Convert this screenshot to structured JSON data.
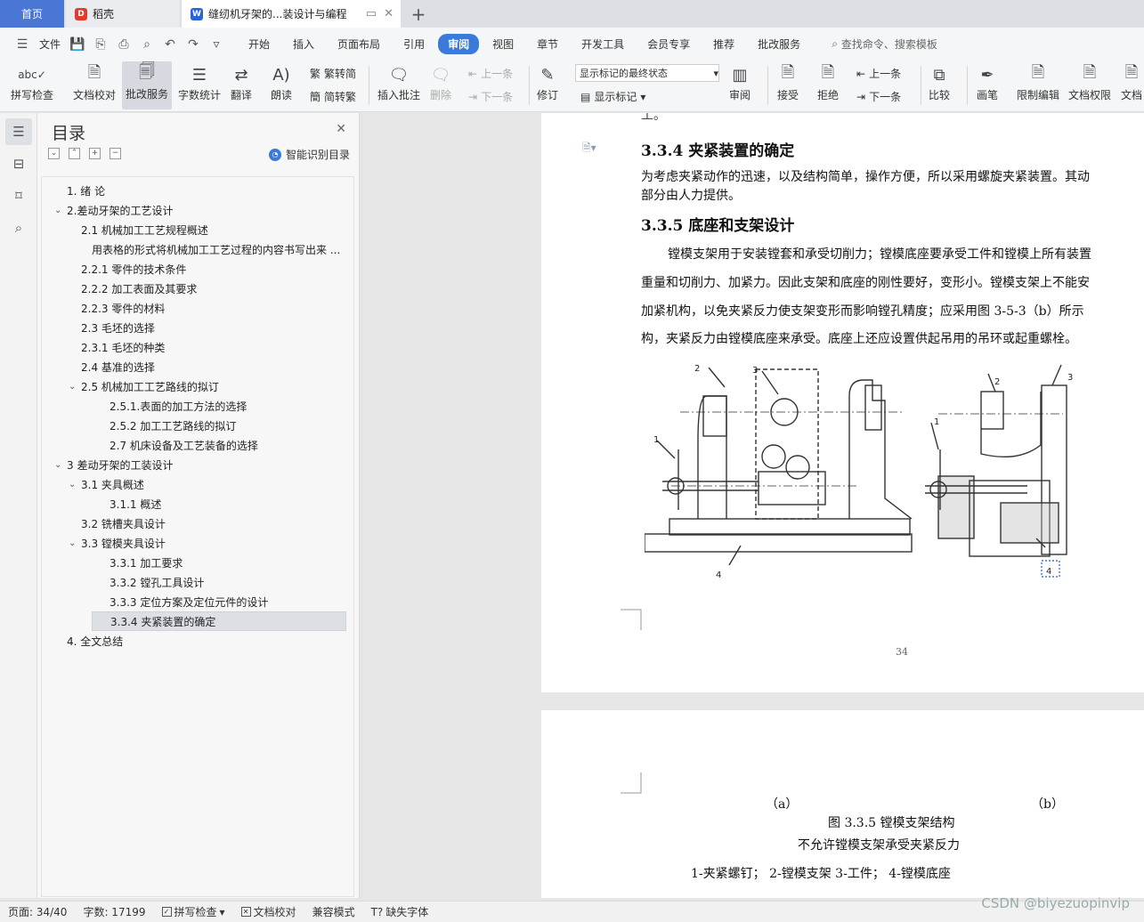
{
  "tabs": {
    "home": "首页",
    "daoke": "稻壳",
    "doc": "缝纫机牙架的...装设计与编程"
  },
  "menu": {
    "file": "文件",
    "tabs": [
      "开始",
      "插入",
      "页面布局",
      "引用",
      "审阅",
      "视图",
      "章节",
      "开发工具",
      "会员专享",
      "推荐",
      "批改服务"
    ],
    "active_tab": "审阅",
    "search": "查找命令、搜索模板"
  },
  "ribbon": {
    "spell": "拼写检查",
    "proofread": "文档校对",
    "correction": "批改服务",
    "wordcount": "字数统计",
    "translate": "翻译",
    "read": "朗读",
    "trad_simp": "繁转简",
    "simp_trad": "简转繁",
    "insert_comment": "插入批注",
    "delete": "删除",
    "prev_comment": "上一条",
    "next_comment": "下一条",
    "revise": "修订",
    "markup_state": "显示标记的最终状态",
    "show_markup": "显示标记",
    "review": "审阅",
    "accept": "接受",
    "reject": "拒绝",
    "prev": "上一条",
    "next": "下一条",
    "compare": "比较",
    "pen": "画笔",
    "restrict": "限制编辑",
    "permission": "文档权限",
    "more": "文档"
  },
  "toc": {
    "title": "目录",
    "smart": "智能识别目录",
    "items": [
      {
        "text": "1. 绪  论"
      },
      {
        "text": "2.差动牙架的工艺设计"
      },
      {
        "text": "2.1    机械加工工艺规程概述"
      },
      {
        "text": "用表格的形式将机械加工工艺过程的内容书写出来 ..."
      },
      {
        "text": "2.2.1  零件的技术条件"
      },
      {
        "text": "2.2.2  加工表面及其要求"
      },
      {
        "text": "2.2.3 零件的材料"
      },
      {
        "text": "2.3 毛坯的选择"
      },
      {
        "text": "2.3.1 毛坯的种类"
      },
      {
        "text": "2.4  基准的选择"
      },
      {
        "text": "2.5    机械加工工艺路线的拟订"
      },
      {
        "text": "2.5.1.表面的加工方法的选择"
      },
      {
        "text": "2.5.2 加工工艺路线的拟订"
      },
      {
        "text": "2.7 机床设备及工艺装备的选择"
      },
      {
        "text": "3  差动牙架的工装设计"
      },
      {
        "text": "3.1  夹具概述"
      },
      {
        "text": "3.1.1  概述"
      },
      {
        "text": "3.2  铣槽夹具设计"
      },
      {
        "text": "3.3 镗模夹具设计"
      },
      {
        "text": "3.3.1    加工要求"
      },
      {
        "text": "3.3.2    镗孔工具设计"
      },
      {
        "text": "3.3.3 定位方案及定位元件的设计"
      },
      {
        "text": "3.3.4 夹紧装置的确定"
      },
      {
        "text": "4.  全文总结"
      }
    ]
  },
  "doc": {
    "top_fragment": "工。",
    "h334": "3.3.4 夹紧装置的确定",
    "p334_1": "为考虑夹紧动作的迅速，以及结构简单，操作方便，所以采用螺旋夹紧装置。其动",
    "p334_2": "部分由人力提供。",
    "h335": "3.3.5 底座和支架设计",
    "p335_1": "镗模支架用于安装镗套和承受切削力；镗模底座要承受工件和镗模上所有装置",
    "p335_2": "重量和切削力、加紧力。因此支架和底座的刚性要好，变形小。镗模支架上不能安",
    "p335_3": "加紧机构，以免夹紧反力使支架变形而影响镗孔精度；应采用图 3-5-3（b）所示",
    "p335_4": "构，夹紧反力由镗模底座来承受。底座上还应设置供起吊用的吊环或起重螺栓。",
    "fig_labels": [
      "1",
      "2",
      "3",
      "4",
      "1",
      "2",
      "3",
      "4"
    ],
    "page_number": "34",
    "cap_a": "（a）",
    "cap_b": "（b）",
    "fig_title": "图 3.3.5  镗模支架结构",
    "fig_sub": "不允许镗模支架承受夹紧反力",
    "fig_legend": "1-夹紧螺钉；    2-镗模支架      3-工件；        4-镗模底座"
  },
  "status": {
    "page": "页面: 34/40",
    "words": "字数: 17199",
    "spell": "拼写检查",
    "proof": "文档校对",
    "compat": "兼容模式",
    "missing_font": "缺失字体"
  },
  "watermark": "CSDN @biyezuopinvip"
}
